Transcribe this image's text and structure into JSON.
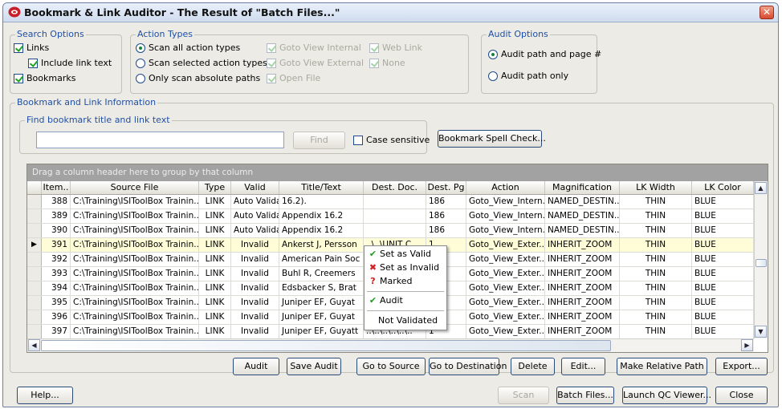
{
  "window": {
    "title": "Bookmark & Link Auditor - The Result of \"Batch Files...\""
  },
  "search_options": {
    "legend": "Search Options",
    "links": "Links",
    "include_link_text": "Include link text",
    "bookmarks": "Bookmarks"
  },
  "action_types": {
    "legend": "Action Types",
    "scan_all": "Scan all action types",
    "scan_selected": "Scan selected action types",
    "only_absolute": "Only scan absolute paths",
    "goto_view_internal": "Goto View Internal",
    "goto_view_external": "Goto View External",
    "open_file": "Open File",
    "web_link": "Web Link",
    "none": "None"
  },
  "audit_options": {
    "legend": "Audit Options",
    "path_and_page": "Audit path and page #",
    "path_only": "Audit path only"
  },
  "info": {
    "legend": "Bookmark and Link Information",
    "find_legend": "Find bookmark title and link text",
    "find_value": "",
    "find_button": "Find",
    "case_sensitive": "Case sensitive",
    "spell_check_button": "Bookmark Spell Check..."
  },
  "grid": {
    "group_hint": "Drag a column header here to group by that column",
    "columns": [
      "Item..",
      "Source File",
      "Type",
      "Valid",
      "Title/Text",
      "Dest. Doc.",
      "Dest. Pg",
      "Action",
      "Magnification",
      "LK Width",
      "LK Color"
    ],
    "rows": [
      {
        "item": "388",
        "source": "C:\\Training\\ISIToolBox Trainin..",
        "type": "LINK",
        "valid": "Auto Valida..",
        "title": "16.2).",
        "dest_doc": "",
        "dest_pg": "186",
        "action": "Goto_View_Intern..",
        "mag": "NAMED_DESTIN..",
        "width": "THIN",
        "color": "BLUE",
        "marker": ""
      },
      {
        "item": "389",
        "source": "C:\\Training\\ISIToolBox Trainin..",
        "type": "LINK",
        "valid": "Auto Valida..",
        "title": "Appendix 16.2",
        "dest_doc": "",
        "dest_pg": "186",
        "action": "Goto_View_Intern..",
        "mag": "NAMED_DESTIN..",
        "width": "THIN",
        "color": "BLUE",
        "marker": ""
      },
      {
        "item": "390",
        "source": "C:\\Training\\ISIToolBox Trainin..",
        "type": "LINK",
        "valid": "Auto Valida..",
        "title": "Appendix 16.2",
        "dest_doc": "",
        "dest_pg": "186",
        "action": "Goto_View_Intern..",
        "mag": "NAMED_DESTIN..",
        "width": "THIN",
        "color": "BLUE",
        "marker": ""
      },
      {
        "item": "391",
        "source": "C:\\Training\\ISIToolBox Trainin..",
        "type": "LINK",
        "valid": "Invalid",
        "title": "Ankerst J, Persson",
        "dest_doc": "..\\..\\UNIT C..",
        "dest_pg": "1",
        "action": "Goto_View_Exter..",
        "mag": "INHERIT_ZOOM",
        "width": "THIN",
        "color": "BLUE",
        "marker": "▶"
      },
      {
        "item": "392",
        "source": "C:\\Training\\ISIToolBox Trainin..",
        "type": "LINK",
        "valid": "Invalid",
        "title": "American Pain Soc",
        "dest_doc": "",
        "dest_pg": "",
        "action": "Goto_View_Exter..",
        "mag": "INHERIT_ZOOM",
        "width": "THIN",
        "color": "BLUE",
        "marker": ""
      },
      {
        "item": "393",
        "source": "C:\\Training\\ISIToolBox Trainin..",
        "type": "LINK",
        "valid": "Invalid",
        "title": "Buhl R, Creemers",
        "dest_doc": "",
        "dest_pg": "",
        "action": "Goto_View_Exter..",
        "mag": "INHERIT_ZOOM",
        "width": "THIN",
        "color": "BLUE",
        "marker": ""
      },
      {
        "item": "394",
        "source": "C:\\Training\\ISIToolBox Trainin..",
        "type": "LINK",
        "valid": "Invalid",
        "title": "Edsbacker S, Brat",
        "dest_doc": "",
        "dest_pg": "",
        "action": "Goto_View_Exter..",
        "mag": "INHERIT_ZOOM",
        "width": "THIN",
        "color": "BLUE",
        "marker": ""
      },
      {
        "item": "395",
        "source": "C:\\Training\\ISIToolBox Trainin..",
        "type": "LINK",
        "valid": "Invalid",
        "title": "Juniper EF, Guyat",
        "dest_doc": "",
        "dest_pg": "",
        "action": "Goto_View_Exter..",
        "mag": "INHERIT_ZOOM",
        "width": "THIN",
        "color": "BLUE",
        "marker": ""
      },
      {
        "item": "396",
        "source": "C:\\Training\\ISIToolBox Trainin..",
        "type": "LINK",
        "valid": "Invalid",
        "title": "Juniper EF, Guyat",
        "dest_doc": "",
        "dest_pg": "",
        "action": "Goto_View_Exter..",
        "mag": "INHERIT_ZOOM",
        "width": "THIN",
        "color": "BLUE",
        "marker": ""
      },
      {
        "item": "397",
        "source": "C:\\Training\\ISIToolBox Trainin..",
        "type": "LINK",
        "valid": "Invalid",
        "title": "Juniper EF, Guyatt",
        "dest_doc": "..\\..\\..\\..\\..\\..",
        "dest_pg": "1",
        "action": "Goto_View_Exter..",
        "mag": "INHERIT_ZOOM",
        "width": "THIN",
        "color": "BLUE",
        "marker": ""
      }
    ]
  },
  "context_menu": {
    "set_valid": "Set as Valid",
    "set_invalid": "Set as Invalid",
    "marked": "Marked",
    "audit": "Audit",
    "not_validated": "Not Validated"
  },
  "actions": {
    "audit": "Audit",
    "save_audit": "Save Audit",
    "go_to_source": "Go to Source",
    "go_to_destination": "Go to Destination",
    "delete": "Delete",
    "edit": "Edit...",
    "make_relative": "Make Relative Path",
    "export": "Export..."
  },
  "footer": {
    "help": "Help...",
    "scan": "Scan",
    "batch_files": "Batch Files...",
    "launch_qc": "Launch QC Viewer...",
    "close": "Close"
  },
  "colors": {
    "legend_blue": "#1f4fa8",
    "check_green": "#21a121",
    "selected_row": "#fffdd8",
    "close_red": "#d84a2e"
  }
}
